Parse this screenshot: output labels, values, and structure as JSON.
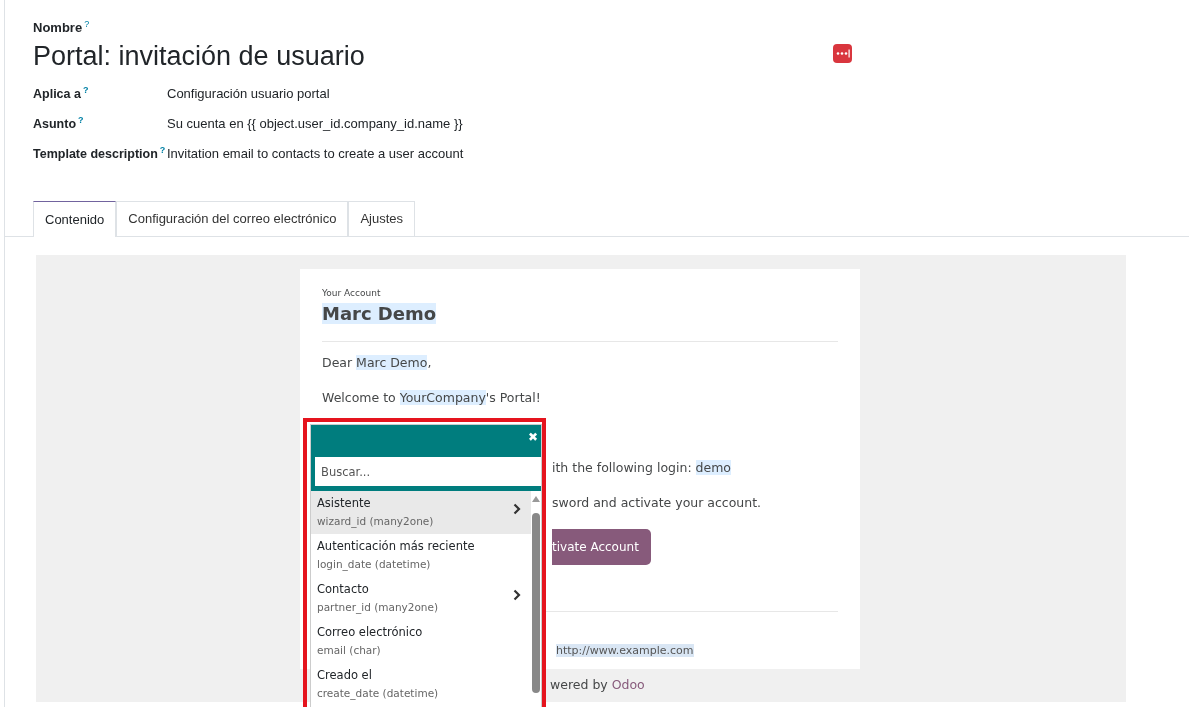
{
  "header": {
    "name_label": "Nombre",
    "name_help": "?",
    "title": "Portal: invitación de usuario"
  },
  "fields": [
    {
      "label": "Aplica a",
      "help": "?",
      "value": "Configuración usuario portal"
    },
    {
      "label": "Asunto",
      "help": "?",
      "value": "Su cuenta en {{ object.user_id.company_id.name }}"
    },
    {
      "label": "Template description",
      "help": "?",
      "value": "Invitation email to contacts to create a user account"
    }
  ],
  "tabs": [
    {
      "label": "Contenido",
      "selected": true
    },
    {
      "label": "Configuración del correo electrónico",
      "selected": false
    },
    {
      "label": "Ajustes",
      "selected": false
    }
  ],
  "email": {
    "kicker": "Your Account",
    "heading": "Marc Demo",
    "lines": [
      {
        "kind": "full",
        "parts": [
          {
            "text": "Dear ",
            "highlighted": false
          },
          {
            "text": "Marc Demo",
            "highlighted": true
          },
          {
            "text": ",",
            "highlighted": false
          }
        ]
      },
      {
        "kind": "full",
        "parts": [
          {
            "text": "Welcome to ",
            "highlighted": false
          },
          {
            "text": "YourCompany",
            "highlighted": true
          },
          {
            "text": "'s Portal!",
            "highlighted": false
          }
        ]
      },
      {
        "kind": "covered",
        "parts": [
          {
            "text": "ith the following login: ",
            "highlighted": false
          },
          {
            "text": "demo",
            "highlighted": true
          }
        ]
      },
      {
        "kind": "covered",
        "parts": [
          {
            "text": "sword and activate your account.",
            "highlighted": false
          }
        ]
      }
    ],
    "button": "tivate Account",
    "url": "http://www.example.com",
    "footer_text": "wered by ",
    "footer_link": "Odoo"
  },
  "field_picker": {
    "close": "✖",
    "search_placeholder": "Buscar...",
    "items": [
      {
        "label": "Asistente",
        "field": "wizard_id (many2one)",
        "has_children": true,
        "selected": true
      },
      {
        "label": "Autenticación más reciente",
        "field": "login_date (datetime)",
        "has_children": false,
        "selected": false
      },
      {
        "label": "Contacto",
        "field": "partner_id (many2one)",
        "has_children": true,
        "selected": false
      },
      {
        "label": "Correo electrónico",
        "field": "email (char)",
        "has_children": false,
        "selected": false
      },
      {
        "label": "Creado el",
        "field": "create_date (datetime)",
        "has_children": false,
        "selected": false
      }
    ]
  }
}
